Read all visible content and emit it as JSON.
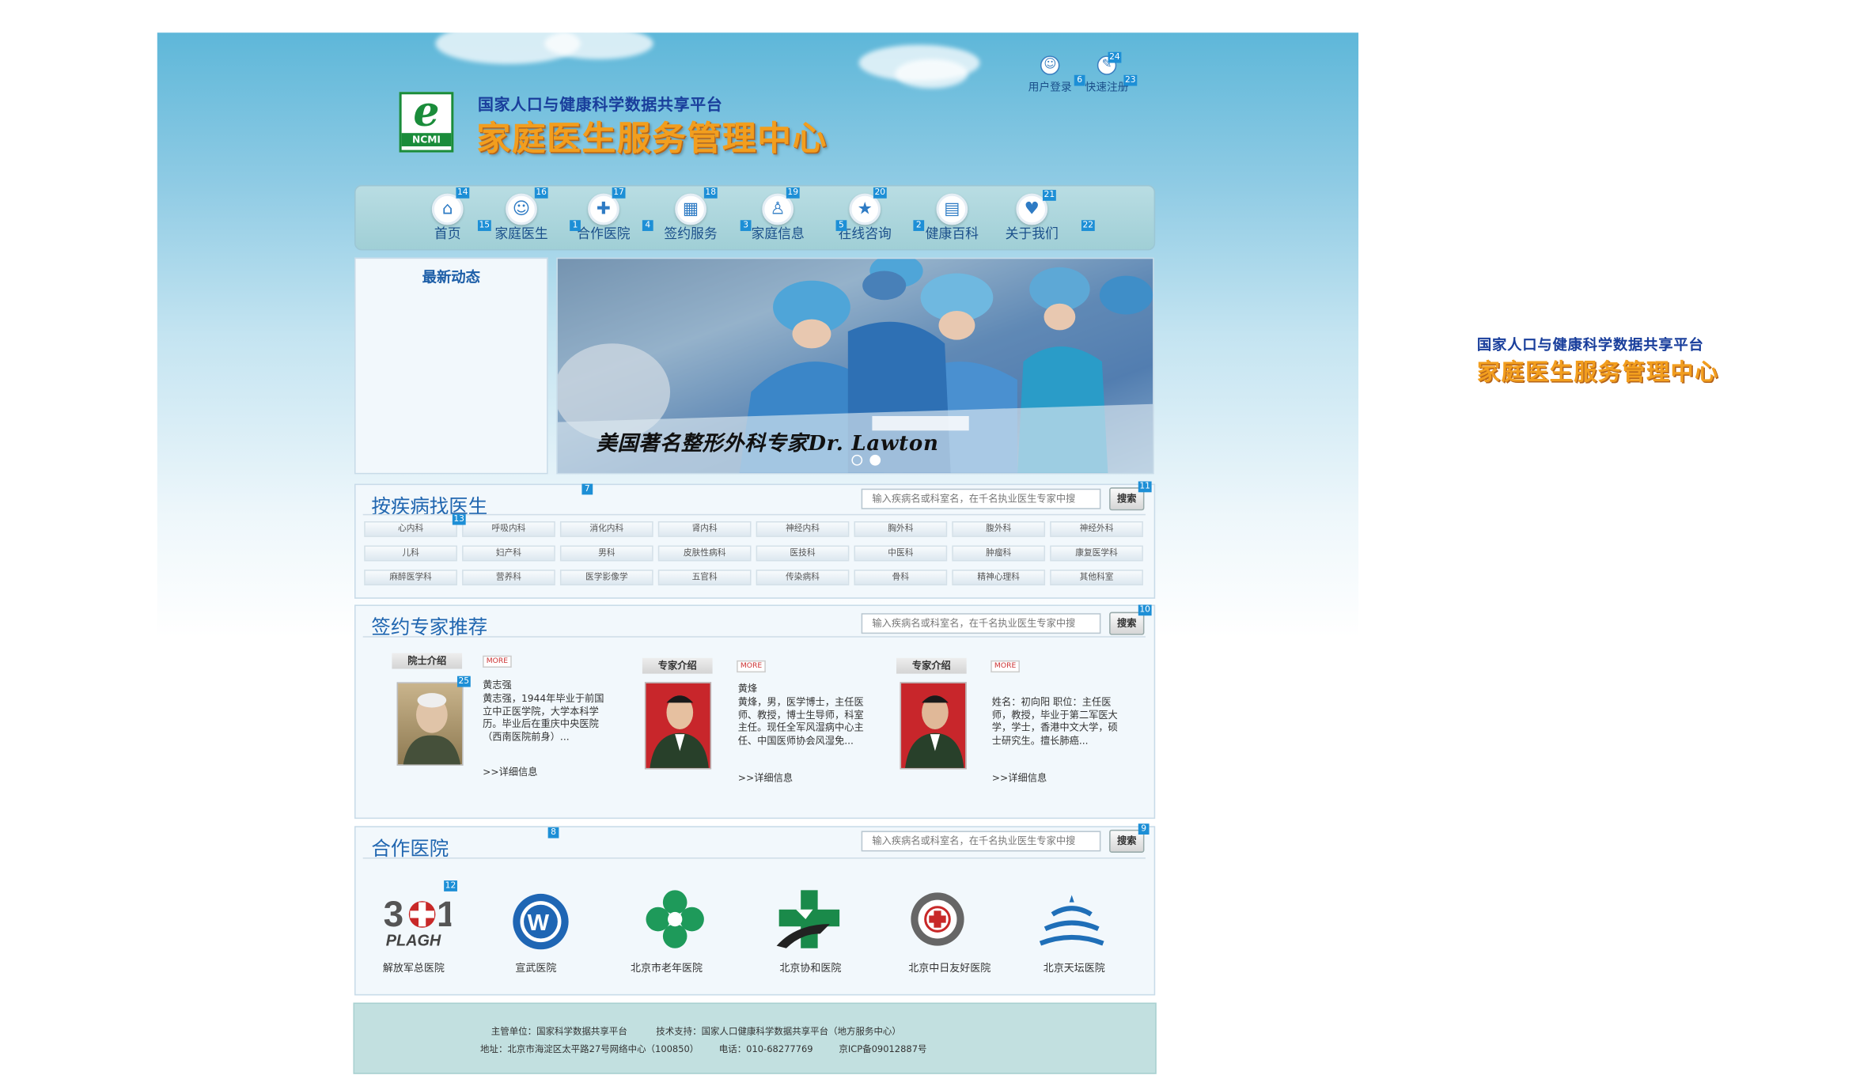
{
  "header": {
    "platform": "国家人口与健康科学数据共享平台",
    "center": "家庭医生服务管理中心",
    "login": "用户登录",
    "register": "快速注册"
  },
  "nav": [
    {
      "label": "首页",
      "icon": "house-icon"
    },
    {
      "label": "家庭医生",
      "icon": "doctor-icon"
    },
    {
      "label": "合作医院",
      "icon": "medical-kit-icon"
    },
    {
      "label": "签约服务",
      "icon": "calendar-icon"
    },
    {
      "label": "家庭信息",
      "icon": "family-icon"
    },
    {
      "label": "在线咨询",
      "icon": "star-chat-icon"
    },
    {
      "label": "健康百科",
      "icon": "book-icon"
    },
    {
      "label": "关于我们",
      "icon": "handshake-icon"
    }
  ],
  "news": {
    "title": "最新动态"
  },
  "slider": {
    "caption": "美国著名整形外科专家Dr. Lawton",
    "slide_count": 2,
    "active_slide": 2
  },
  "search": {
    "placeholder": "输入疾病名或科室名，在千名执业医生专家中搜",
    "button": "搜索"
  },
  "sections": {
    "find_by_disease": "按疾病找医生",
    "experts": "签约专家推荐",
    "hospitals": "合作医院"
  },
  "departments": [
    "心内科",
    "呼吸内科",
    "消化内科",
    "肾内科",
    "神经内科",
    "胸外科",
    "腹外科",
    "神经外科",
    "儿科",
    "妇产科",
    "男科",
    "皮肤性病科",
    "医技科",
    "中医科",
    "肿瘤科",
    "康复医学科",
    "麻醉医学科",
    "营养科",
    "医学影像学",
    "五官科",
    "传染病科",
    "骨科",
    "精神心理科",
    "其他科室"
  ],
  "expert_cards": [
    {
      "head": "院士介绍",
      "more": "MORE",
      "name": "黄志强",
      "desc": "黄志强，1944年毕业于前国立中正医学院，大学本科学历。毕业后在重庆中央医院（西南医院前身）...",
      "link": ">>详细信息"
    },
    {
      "head": "专家介绍",
      "more": "MORE",
      "name": "黄烽",
      "desc": "黄烽，男，医学博士，主任医师、教授，博士生导师，科室主任。现任全军风湿病中心主任、中国医师协会风湿免...",
      "link": ">>详细信息"
    },
    {
      "head": "专家介绍",
      "more": "MORE",
      "name": "",
      "desc": "姓名：初向阳 职位：主任医师，教授，毕业于第二军医大学，学士，香港中文大学，硕士研究生。擅长肺癌...",
      "link": ">>详细信息"
    }
  ],
  "hospitals": [
    {
      "name": "解放军总医院",
      "logo": "301-plagh-logo"
    },
    {
      "name": "宣武医院",
      "logo": "xuanwu-logo"
    },
    {
      "name": "北京市老年医院",
      "logo": "geriatric-clover-logo"
    },
    {
      "name": "北京协和医院",
      "logo": "pumch-cross-logo"
    },
    {
      "name": "北京中日友好医院",
      "logo": "china-japan-logo"
    },
    {
      "name": "北京天坛医院",
      "logo": "tiantan-logo"
    }
  ],
  "footer": {
    "line1": "主管单位：国家科学数据共享平台          技术支持：国家人口健康科学数据共享平台（地方服务中心）",
    "line2": "地址：北京市海淀区太平路27号网络中心（100850）       电话：010-68277769         京ICP备09012887号"
  },
  "tags": {
    "t1": "1",
    "t2": "2",
    "t3": "3",
    "t4": "4",
    "t5": "5",
    "t6": "6",
    "t7": "7",
    "t8": "8",
    "t9": "9",
    "t10": "10",
    "t11": "11",
    "t12": "12",
    "t13": "13",
    "t14": "14",
    "t15": "15",
    "t16": "16",
    "t17": "17",
    "t18": "18",
    "t19": "19",
    "t20": "20",
    "t21": "21",
    "t22": "22",
    "t23": "23",
    "t24": "24",
    "t25": "25"
  },
  "colors": {
    "accent": "#2066b0",
    "title_orange": "#f29e1e",
    "nav_bg": "#a0cfd6",
    "footer_bg": "#c2e0e0",
    "tag_blue": "#1d8fd6"
  }
}
